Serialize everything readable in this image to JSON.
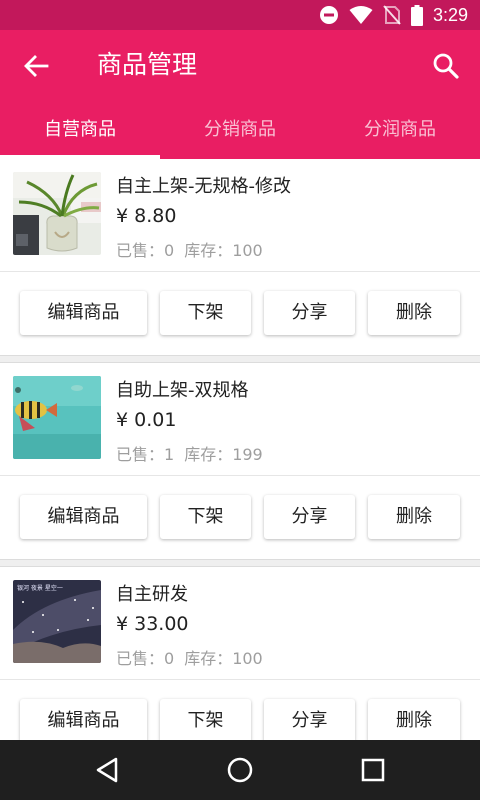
{
  "status_bar": {
    "time": "3:29",
    "icons": [
      "do-not-disturb-icon",
      "wifi-icon",
      "no-sim-icon",
      "battery-icon"
    ]
  },
  "app_bar": {
    "title": "商品管理",
    "back_icon": "arrow-left-icon",
    "search_icon": "search-icon",
    "color": "#e91e63"
  },
  "tabs": [
    {
      "label": "自营商品",
      "active": true
    },
    {
      "label": "分销商品",
      "active": false
    },
    {
      "label": "分润商品",
      "active": false
    }
  ],
  "products": [
    {
      "name": "自主上架-无规格-修改",
      "price": "¥ 8.80",
      "sold": "已售：0",
      "stock": "库存：100",
      "thumb": "plant-photo"
    },
    {
      "name": "自助上架-双规格",
      "price": "¥ 0.01",
      "sold": "已售：1",
      "stock": "库存：199",
      "thumb": "fish-photo"
    },
    {
      "name": "自主研发",
      "price": "¥ 33.00",
      "sold": "已售：0",
      "stock": "库存：100",
      "thumb": "night-sky-photo"
    }
  ],
  "actions": {
    "edit": "编辑商品",
    "unlist": "下架",
    "share": "分享",
    "delete": "删除"
  },
  "thumb_caption": "银河 夜景 星空一",
  "nav_bar": {
    "icons": [
      "back-triangle-icon",
      "home-circle-icon",
      "recents-square-icon"
    ]
  }
}
